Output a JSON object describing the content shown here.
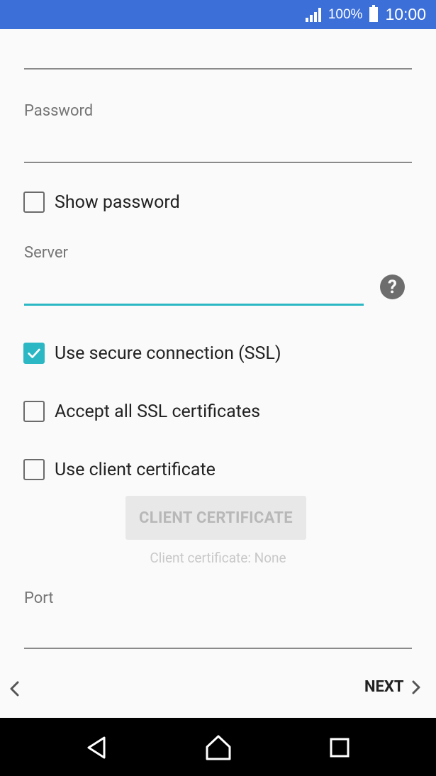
{
  "status_bar": {
    "battery_text": "100%",
    "time": "10:00"
  },
  "form": {
    "password_label": "Password",
    "show_password_label": "Show password",
    "server_label": "Server",
    "ssl_label": "Use secure connection (SSL)",
    "ssl_checked": true,
    "accept_all_label": "Accept all SSL certificates",
    "accept_all_checked": false,
    "client_cert_label": "Use client certificate",
    "client_cert_checked": false,
    "client_cert_button": "CLIENT CERTIFICATE",
    "client_cert_status": "Client certificate: None",
    "port_label": "Port",
    "help_glyph": "?"
  },
  "footer": {
    "next_label": "NEXT"
  },
  "colors": {
    "status_bar": "#3c6fd8",
    "accent": "#2bb8c4",
    "background": "#fafafa"
  },
  "icons": [
    "signal-icon",
    "battery-icon",
    "help-icon",
    "check-icon",
    "chevron-left-icon",
    "chevron-right-icon",
    "back-icon",
    "home-icon",
    "recents-icon"
  ]
}
